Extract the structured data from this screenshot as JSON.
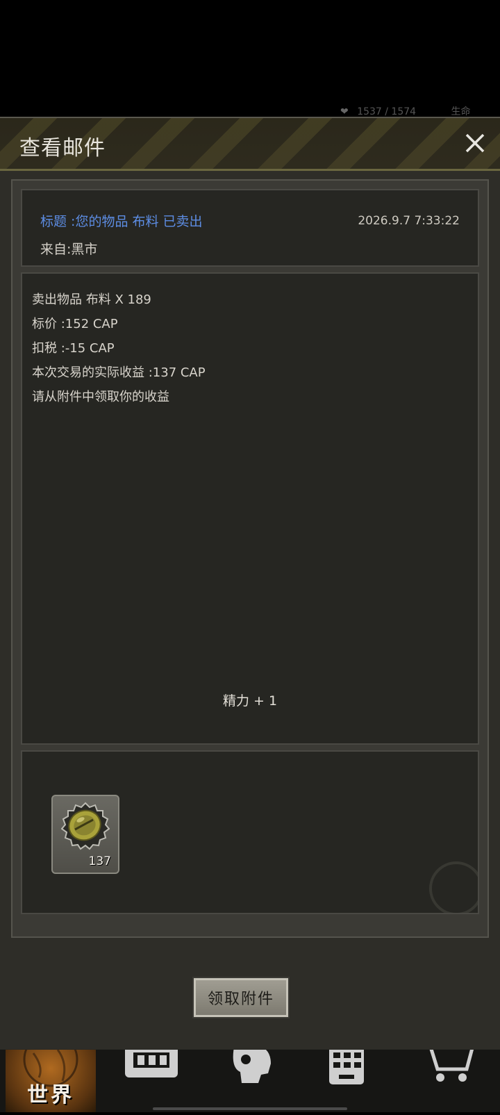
{
  "background_status": {
    "hp": "1537 / 1574",
    "label": "生命"
  },
  "dialog": {
    "title": "查看邮件",
    "subject": "标题 :您的物品 布料 已卖出",
    "from": "来自:黑市",
    "datetime": "2026.9.7 7:33:22",
    "body_lines": [
      "卖出物品 布料 X 189",
      "标价 :152 CAP",
      "扣税 :-15 CAP",
      "本次交易的实际收益 :137 CAP",
      "请从附件中领取你的收益"
    ],
    "bonus": "精力 + 1",
    "attachment": {
      "icon": "bottle-cap-icon",
      "count": "137"
    },
    "claim_button": "领取附件"
  },
  "nav": {
    "items": [
      {
        "label": "世界",
        "icon": "globe-icon",
        "active": true
      },
      {
        "label": "",
        "icon": "backpack-icon"
      },
      {
        "label": "",
        "icon": "head-skill-icon"
      },
      {
        "label": "",
        "icon": "building-icon"
      },
      {
        "label": "",
        "icon": "cart-icon"
      }
    ]
  },
  "colors": {
    "subject": "#5d8de4",
    "panel": "#262622",
    "header_stripe": "#6b6233",
    "world_tab": "#b06a20"
  }
}
